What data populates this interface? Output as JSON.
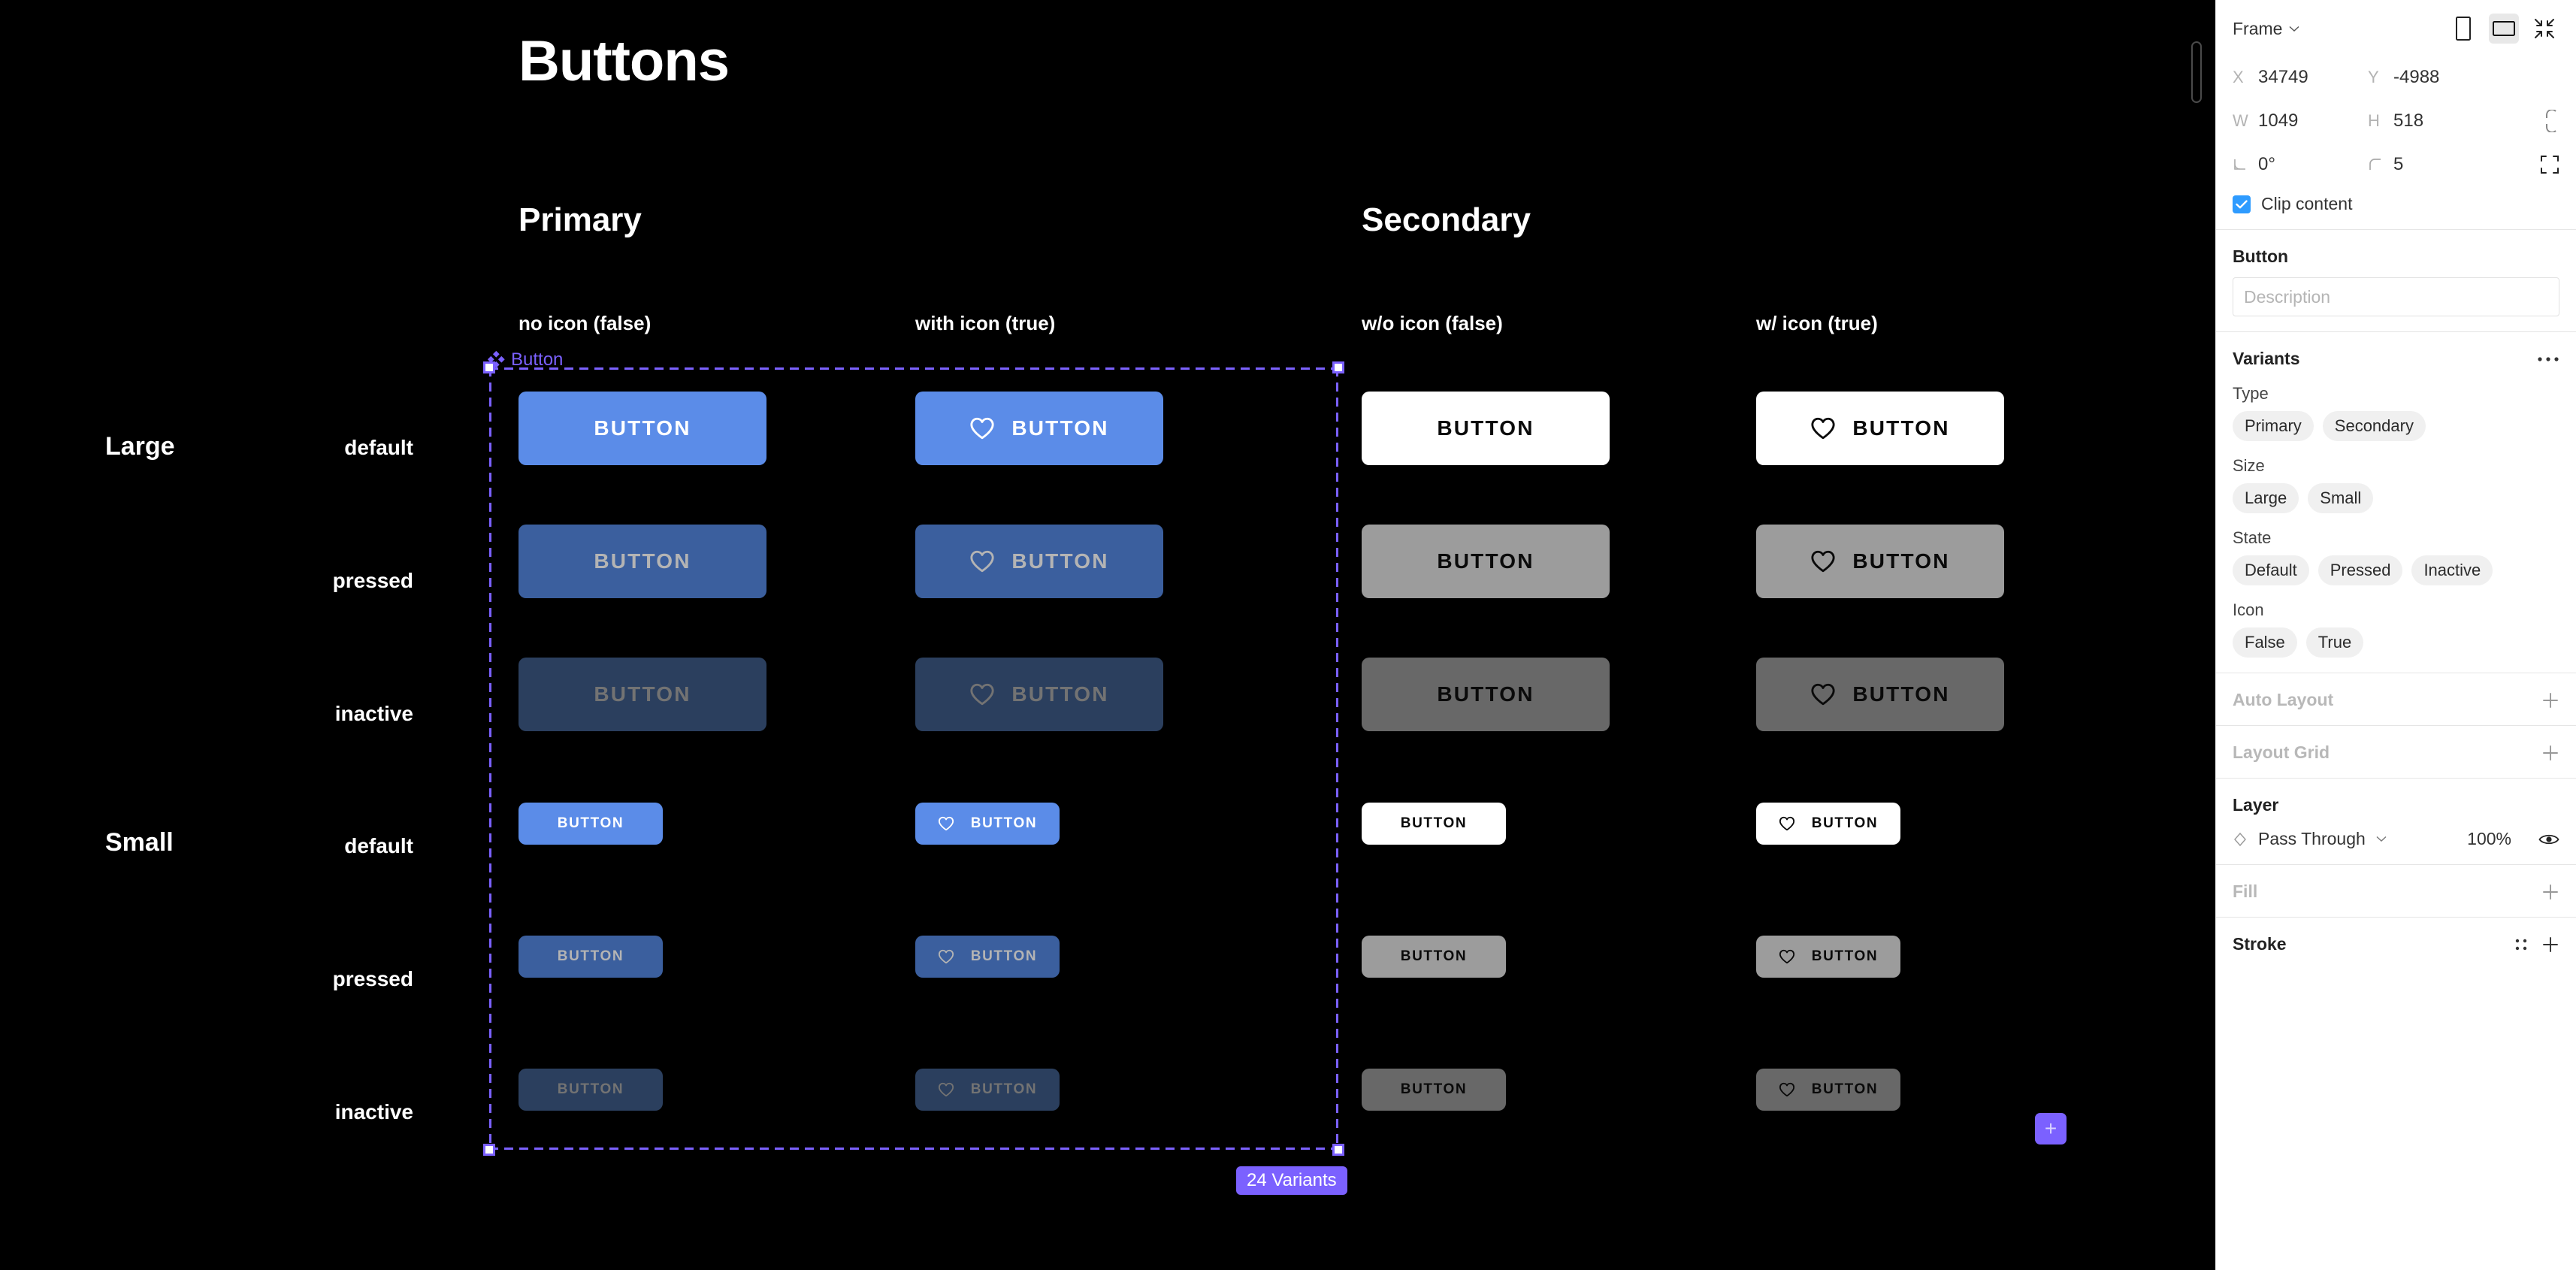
{
  "canvas": {
    "page_title": "Buttons",
    "groups": [
      {
        "label": "Primary"
      },
      {
        "label": "Secondary"
      }
    ],
    "column_headers": [
      "no icon (false)",
      "with icon (true)",
      "w/o icon (false)",
      "w/ icon (true)"
    ],
    "size_labels": [
      "Large",
      "Small"
    ],
    "state_labels": [
      "default",
      "pressed",
      "inactive",
      "default",
      "pressed",
      "inactive"
    ],
    "component_badge": {
      "label": "Button",
      "icon": "component-diamond-icon"
    },
    "variants_badge": "24 Variants",
    "add_variant_label": "+",
    "button_label": "BUTTON",
    "colors": {
      "primary_default": "#5b8ce8",
      "primary_pressed": "#3b5f9e",
      "primary_inactive": "#2b3f5e",
      "primary_default_text": "#ffffff",
      "primary_pressed_text": "#b4b4b4",
      "primary_inactive_text": "#737373",
      "secondary_default": "#ffffff",
      "secondary_pressed": "#9c9c9c",
      "secondary_inactive": "#686868",
      "secondary_text": "#0a0a0a",
      "selection": "#7b61ff",
      "canvas_bg": "#000000"
    },
    "buttons": [
      {
        "size": "large",
        "state": "default",
        "type": "primary",
        "icon": false,
        "bg": "#5b8ce8",
        "fg": "#ffffff"
      },
      {
        "size": "large",
        "state": "default",
        "type": "primary",
        "icon": true,
        "bg": "#5b8ce8",
        "fg": "#ffffff"
      },
      {
        "size": "large",
        "state": "default",
        "type": "secondary",
        "icon": false,
        "bg": "#ffffff",
        "fg": "#0a0a0a"
      },
      {
        "size": "large",
        "state": "default",
        "type": "secondary",
        "icon": true,
        "bg": "#ffffff",
        "fg": "#0a0a0a"
      },
      {
        "size": "large",
        "state": "pressed",
        "type": "primary",
        "icon": false,
        "bg": "#3b5f9e",
        "fg": "#b4b4b4"
      },
      {
        "size": "large",
        "state": "pressed",
        "type": "primary",
        "icon": true,
        "bg": "#3b5f9e",
        "fg": "#b4b4b4"
      },
      {
        "size": "large",
        "state": "pressed",
        "type": "secondary",
        "icon": false,
        "bg": "#9c9c9c",
        "fg": "#0a0a0a"
      },
      {
        "size": "large",
        "state": "pressed",
        "type": "secondary",
        "icon": true,
        "bg": "#9c9c9c",
        "fg": "#0a0a0a"
      },
      {
        "size": "large",
        "state": "inactive",
        "type": "primary",
        "icon": false,
        "bg": "#2b3f5e",
        "fg": "#737373"
      },
      {
        "size": "large",
        "state": "inactive",
        "type": "primary",
        "icon": true,
        "bg": "#2b3f5e",
        "fg": "#737373"
      },
      {
        "size": "large",
        "state": "inactive",
        "type": "secondary",
        "icon": false,
        "bg": "#686868",
        "fg": "#0a0a0a"
      },
      {
        "size": "large",
        "state": "inactive",
        "type": "secondary",
        "icon": true,
        "bg": "#686868",
        "fg": "#0a0a0a"
      },
      {
        "size": "small",
        "state": "default",
        "type": "primary",
        "icon": false,
        "bg": "#5b8ce8",
        "fg": "#ffffff"
      },
      {
        "size": "small",
        "state": "default",
        "type": "primary",
        "icon": true,
        "bg": "#5b8ce8",
        "fg": "#ffffff"
      },
      {
        "size": "small",
        "state": "default",
        "type": "secondary",
        "icon": false,
        "bg": "#ffffff",
        "fg": "#0a0a0a"
      },
      {
        "size": "small",
        "state": "default",
        "type": "secondary",
        "icon": true,
        "bg": "#ffffff",
        "fg": "#0a0a0a"
      },
      {
        "size": "small",
        "state": "pressed",
        "type": "primary",
        "icon": false,
        "bg": "#3b5f9e",
        "fg": "#b4b4b4"
      },
      {
        "size": "small",
        "state": "pressed",
        "type": "primary",
        "icon": true,
        "bg": "#3b5f9e",
        "fg": "#b4b4b4"
      },
      {
        "size": "small",
        "state": "pressed",
        "type": "secondary",
        "icon": false,
        "bg": "#9c9c9c",
        "fg": "#0a0a0a"
      },
      {
        "size": "small",
        "state": "pressed",
        "type": "secondary",
        "icon": true,
        "bg": "#9c9c9c",
        "fg": "#0a0a0a"
      },
      {
        "size": "small",
        "state": "inactive",
        "type": "primary",
        "icon": false,
        "bg": "#2b3f5e",
        "fg": "#737373"
      },
      {
        "size": "small",
        "state": "inactive",
        "type": "primary",
        "icon": true,
        "bg": "#2b3f5e",
        "fg": "#737373"
      },
      {
        "size": "small",
        "state": "inactive",
        "type": "secondary",
        "icon": false,
        "bg": "#686868",
        "fg": "#0a0a0a"
      },
      {
        "size": "small",
        "state": "inactive",
        "type": "secondary",
        "icon": true,
        "bg": "#686868",
        "fg": "#0a0a0a"
      }
    ]
  },
  "panel": {
    "object_type": "Frame",
    "top_icons": [
      "portrait-orientation-icon",
      "landscape-orientation-icon",
      "collapse-icon"
    ],
    "transform": {
      "x_key": "X",
      "x_value": "34749",
      "y_key": "Y",
      "y_value": "-4988",
      "w_key": "W",
      "w_value": "1049",
      "h_key": "H",
      "h_value": "518",
      "rotation_value": "0°",
      "corner_radius_value": "5"
    },
    "clip_content": {
      "label": "Clip content",
      "checked": true
    },
    "component": {
      "name": "Button",
      "description_placeholder": "Description"
    },
    "variants": {
      "title": "Variants",
      "properties": [
        {
          "name": "Type",
          "values": [
            "Primary",
            "Secondary"
          ]
        },
        {
          "name": "Size",
          "values": [
            "Large",
            "Small"
          ]
        },
        {
          "name": "State",
          "values": [
            "Default",
            "Pressed",
            "Inactive"
          ]
        },
        {
          "name": "Icon",
          "values": [
            "False",
            "True"
          ]
        }
      ]
    },
    "auto_layout": {
      "title": "Auto Layout"
    },
    "layout_grid": {
      "title": "Layout Grid"
    },
    "layer": {
      "title": "Layer",
      "blend_mode": "Pass Through",
      "opacity": "100%"
    },
    "fill": {
      "title": "Fill"
    },
    "stroke": {
      "title": "Stroke"
    }
  }
}
